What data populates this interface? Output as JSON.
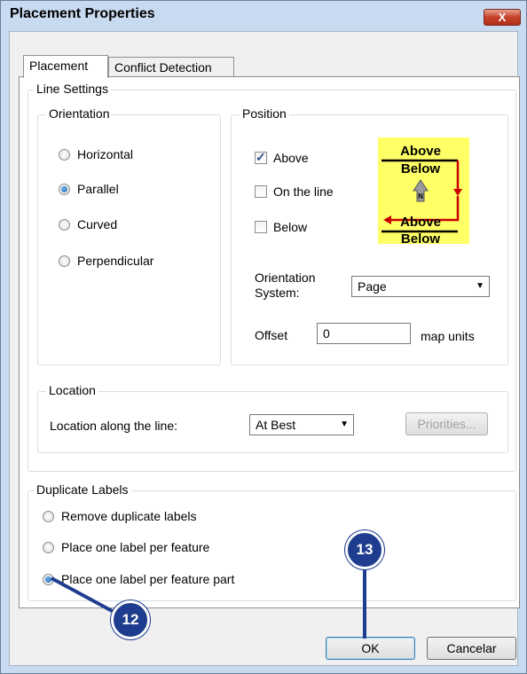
{
  "window": {
    "title": "Placement Properties",
    "close_label": "X"
  },
  "tabs": [
    {
      "label": "Placement"
    },
    {
      "label": "Conflict Detection"
    }
  ],
  "line_settings": {
    "label": "Line Settings",
    "orientation": {
      "label": "Orientation",
      "options": [
        {
          "label": "Horizontal",
          "selected": false
        },
        {
          "label": "Parallel",
          "selected": true
        },
        {
          "label": "Curved",
          "selected": false
        },
        {
          "label": "Perpendicular",
          "selected": false
        }
      ]
    },
    "position": {
      "label": "Position",
      "checks": [
        {
          "label": "Above",
          "checked": true
        },
        {
          "label": "On the line",
          "checked": false
        },
        {
          "label": "Below",
          "checked": false
        }
      ],
      "diagram": {
        "above_1": "Above",
        "below_1": "Below",
        "north": "N",
        "above_2": "Above",
        "below_2": "Below"
      },
      "orientation_system_label_1": "Orientation",
      "orientation_system_label_2": "System:",
      "orientation_system_value": "Page",
      "offset_label": "Offset",
      "offset_value": "0",
      "offset_units": "map units"
    },
    "location": {
      "label": "Location",
      "along_label": "Location along the line:",
      "along_value": "At Best",
      "priorities_label": "Priorities..."
    }
  },
  "duplicate_labels": {
    "label": "Duplicate Labels",
    "options": [
      {
        "label": "Remove duplicate labels",
        "selected": false
      },
      {
        "label": "Place one label per feature",
        "selected": false
      },
      {
        "label": "Place one label per feature part",
        "selected": true
      }
    ]
  },
  "buttons": {
    "ok": "OK",
    "cancel": "Cancelar"
  },
  "callouts": [
    {
      "number": "12"
    },
    {
      "number": "13"
    }
  ],
  "colors": {
    "callout": "#1f3d8f",
    "diagram_bg": "#ffff66",
    "diagram_arrow": "#cc0000"
  }
}
